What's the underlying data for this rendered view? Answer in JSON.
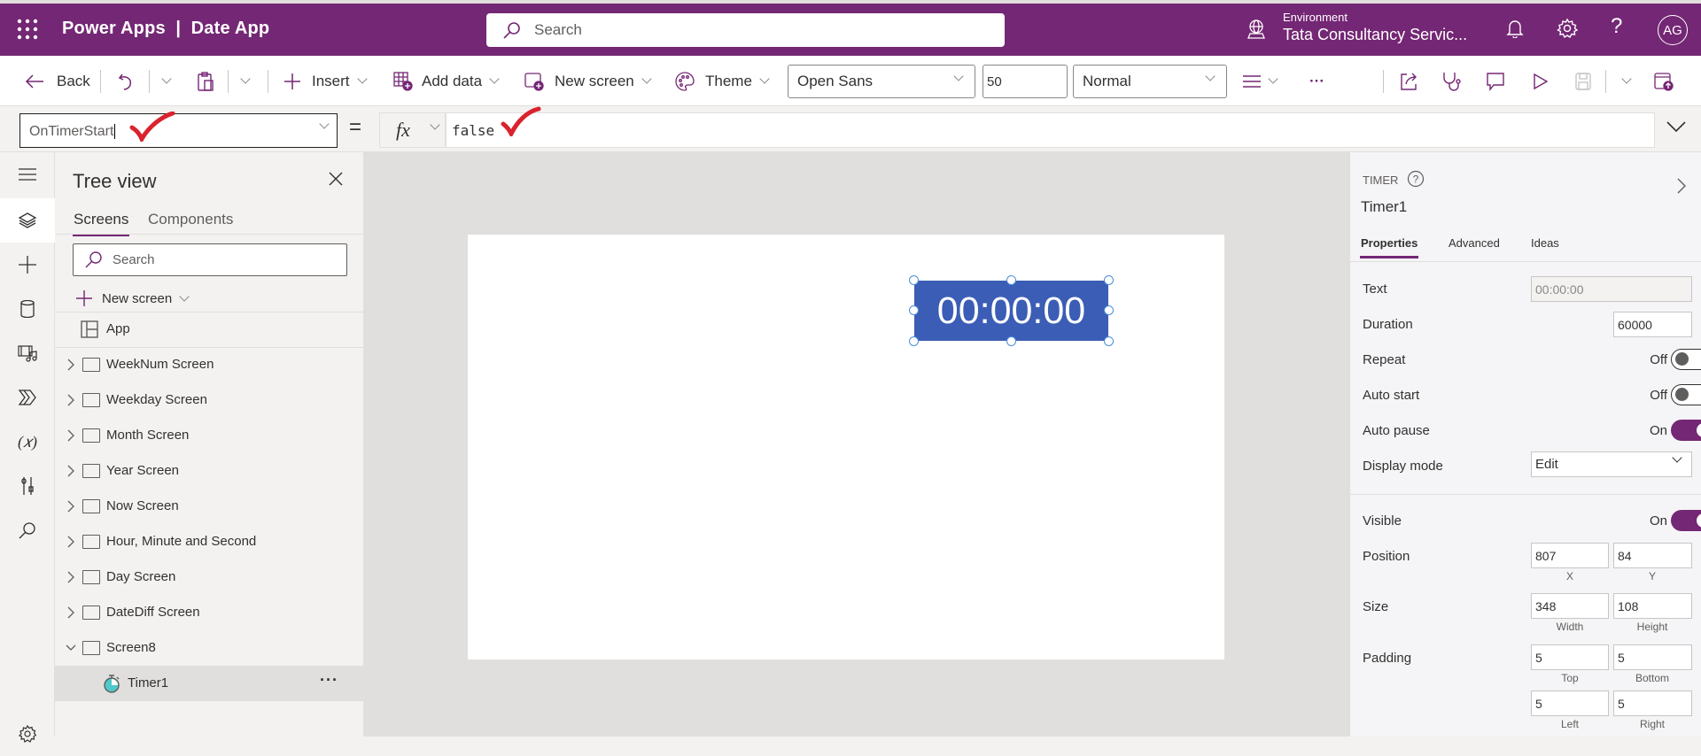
{
  "header": {
    "app_title": "Power Apps  |  Date App",
    "search_placeholder": "Search",
    "environment_label": "Environment",
    "environment_value": "Tata Consultancy Servic...",
    "help_glyph": "?",
    "avatar_initials": "AG",
    "brand_color": "#742774"
  },
  "toolbar": {
    "back_label": "Back",
    "insert_label": "Insert",
    "add_data_label": "Add data",
    "new_screen_label": "New screen",
    "theme_label": "Theme",
    "font_value": "Open Sans",
    "font_size_value": "50",
    "font_weight_value": "Normal",
    "more_label": "···"
  },
  "formula_bar": {
    "property": "OnTimerStart",
    "equals": "=",
    "fx_label": "fx",
    "formula": "false"
  },
  "rail": {
    "items": [
      "hamburger-menu",
      "tree-view",
      "insert",
      "data",
      "media",
      "power-automate",
      "variables",
      "advanced-tools",
      "search",
      "settings"
    ]
  },
  "tree_view": {
    "title": "Tree view",
    "tabs": [
      "Screens",
      "Components"
    ],
    "search_placeholder": "Search",
    "new_screen_label": "New screen",
    "app_label": "App",
    "screens": [
      {
        "label": "WeekNum Screen",
        "expanded": false
      },
      {
        "label": "Weekday Screen",
        "expanded": false
      },
      {
        "label": "Month Screen",
        "expanded": false
      },
      {
        "label": "Year Screen",
        "expanded": false
      },
      {
        "label": "Now Screen",
        "expanded": false
      },
      {
        "label": "Hour, Minute and Second",
        "expanded": false
      },
      {
        "label": "Day Screen",
        "expanded": false
      },
      {
        "label": "DateDiff Screen",
        "expanded": false
      },
      {
        "label": "Screen8",
        "expanded": true
      }
    ],
    "selected_child": {
      "label": "Timer1",
      "more": "···"
    }
  },
  "canvas": {
    "timer_text": "00:00:00",
    "timer_color": "#3b5db5"
  },
  "properties": {
    "control_type": "TIMER",
    "control_name": "Timer1",
    "tabs": [
      "Properties",
      "Advanced",
      "Ideas"
    ],
    "text_label": "Text",
    "text_value": "00:00:00",
    "duration_label": "Duration",
    "duration_value": "60000",
    "repeat_label": "Repeat",
    "repeat_state": "Off",
    "auto_start_label": "Auto start",
    "auto_start_state": "Off",
    "auto_pause_label": "Auto pause",
    "auto_pause_state": "On",
    "display_mode_label": "Display mode",
    "display_mode_value": "Edit",
    "visible_label": "Visible",
    "visible_state": "On",
    "position_label": "Position",
    "position_x": "807",
    "position_y": "84",
    "x_caption": "X",
    "y_caption": "Y",
    "size_label": "Size",
    "size_width": "348",
    "size_height": "108",
    "width_caption": "Width",
    "height_caption": "Height",
    "padding_label": "Padding",
    "padding_top": "5",
    "padding_bottom": "5",
    "padding_left": "5",
    "padding_right": "5",
    "top_caption": "Top",
    "bottom_caption": "Bottom",
    "left_caption": "Left",
    "right_caption": "Right"
  }
}
